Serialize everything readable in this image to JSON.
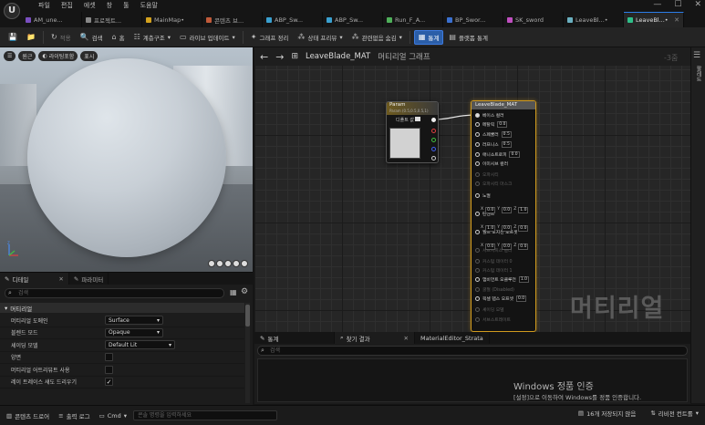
{
  "menu": [
    "파일",
    "편집",
    "에셋",
    "창",
    "툴",
    "도움말"
  ],
  "tabs": [
    {
      "label": "AM_une...",
      "color": "#7a4fc0",
      "active": false
    },
    {
      "label": "프로젝트...",
      "color": "#888888",
      "active": false
    },
    {
      "label": "MainMap•",
      "color": "#d4a21e",
      "active": false
    },
    {
      "label": "콘텐츠 브...",
      "color": "#c05a3a",
      "active": false
    },
    {
      "label": "ABP_Sw...",
      "color": "#3aa0d0",
      "active": false
    },
    {
      "label": "ABP_Sw...",
      "color": "#3aa0d0",
      "active": false
    },
    {
      "label": "Run_F_A...",
      "color": "#4fb05a",
      "active": false
    },
    {
      "label": "BP_Swor...",
      "color": "#3a70d0",
      "active": false
    },
    {
      "label": "SK_sword",
      "color": "#c04fc0",
      "active": false
    },
    {
      "label": "LeaveBl...•",
      "color": "#6ab0c0",
      "active": false
    },
    {
      "label": "LeaveBl...•",
      "color": "#2fbf8a",
      "active": true
    }
  ],
  "toolbar": {
    "save": "save",
    "browse": "browse",
    "apply": "적용",
    "search": "검색",
    "home": "홈",
    "hierarchy": "계층구조",
    "live_update": "라이브 업데이트",
    "clean_graph": "그래프 정리",
    "preview_state": "상태 프리뷰",
    "hide_unrelated": "관련없음 숨김",
    "stats": "통계",
    "platform_stats": "플랫폼 통계"
  },
  "viewport": {
    "buttons": [
      "원근",
      "라이팅포함",
      "표시"
    ]
  },
  "details": {
    "tab_details": "디테일",
    "tab_params": "파라미터",
    "search_placeholder": "검색",
    "section": "머티리얼",
    "rows": [
      {
        "label": "머티리얼 도메인",
        "type": "select",
        "value": "Surface"
      },
      {
        "label": "블렌드 모드",
        "type": "select",
        "value": "Opaque"
      },
      {
        "label": "셰이딩 모델",
        "type": "select",
        "value": "Default Lit",
        "wide": true
      },
      {
        "label": "양면",
        "type": "check",
        "value": ""
      },
      {
        "label": "머티리얼 어트리뷰트 사용",
        "type": "check",
        "value": ""
      },
      {
        "label": "레이 트레이스 섀도 드리우기",
        "type": "check",
        "value": "✓"
      }
    ]
  },
  "graph": {
    "breadcrumb": "LeaveBlade_MAT",
    "breadcrumb_sub": "머티리얼 그래프",
    "zoom": "-3줌",
    "watermark": "머티리얼",
    "right_strip_label": "팔레트"
  },
  "param_node": {
    "title": "Param",
    "subtitle": "Param (0.5,0.5,0.5,1)",
    "pin_label": "디폴트 값"
  },
  "result_node": {
    "title": "LeaveBlade_MAT",
    "pins": [
      {
        "label": "베이스 컬러",
        "state": "filled",
        "val": ""
      },
      {
        "label": "메탈릭",
        "state": "on",
        "val": "0.0"
      },
      {
        "label": "스페큘러",
        "state": "on",
        "val": "0.5"
      },
      {
        "label": "러프니스",
        "state": "on",
        "val": "0.5"
      },
      {
        "label": "애니소트로피",
        "state": "on",
        "val": "0.0"
      },
      {
        "label": "이미시브 컬러",
        "state": "on",
        "val": ""
      },
      {
        "label": "오파시티",
        "state": "off",
        "val": ""
      },
      {
        "label": "오파시티 마스크",
        "state": "off",
        "val": ""
      },
      {
        "label": "노멀",
        "state": "on",
        "val": ""
      },
      {
        "label": "탄젠트",
        "state": "on",
        "val": ""
      },
      {
        "label": "월드 포지션 오프셋",
        "state": "on",
        "val": ""
      },
      {
        "label": "서브서피스 컬러",
        "state": "off",
        "val": ""
      },
      {
        "label": "커스텀 데이터 0",
        "state": "off",
        "val": ""
      },
      {
        "label": "커스텀 데이터 1",
        "state": "off",
        "val": ""
      },
      {
        "label": "앰비언트 오클루전",
        "state": "on",
        "val": "1.0"
      },
      {
        "label": "굴절 (Disabled)",
        "state": "off",
        "val": ""
      },
      {
        "label": "픽셀 뎁스 오프셋",
        "state": "on",
        "val": "0.0"
      },
      {
        "label": "셰이딩 모델",
        "state": "off",
        "val": ""
      },
      {
        "label": "서브스트레이트",
        "state": "off",
        "val": ""
      }
    ],
    "normal_vec": [
      "0.0",
      "0.0",
      "1.0"
    ],
    "tangent_vec": [
      "1.0",
      "0.0",
      "0.0"
    ],
    "wpo_vec": [
      "0.0",
      "0.0",
      "0.0"
    ]
  },
  "bottom": {
    "tab_stats": "통계",
    "tab_find": "찾기 결과",
    "tab_strata": "MaterialEditor_Strata",
    "search_placeholder": "검색",
    "win_activate_title": "Windows 정품 인증",
    "win_activate_sub": "[설정]으로 이동하여 Windows를 정품 인증합니다."
  },
  "status": {
    "content_drawer": "콘텐츠 드로어",
    "output_log": "출력 로그",
    "cmd": "Cmd",
    "cmd_placeholder": "콘솔 명령을 입력하세요",
    "unsaved": "16개 저장되지 않음",
    "revision": "리비전 컨트롤"
  }
}
